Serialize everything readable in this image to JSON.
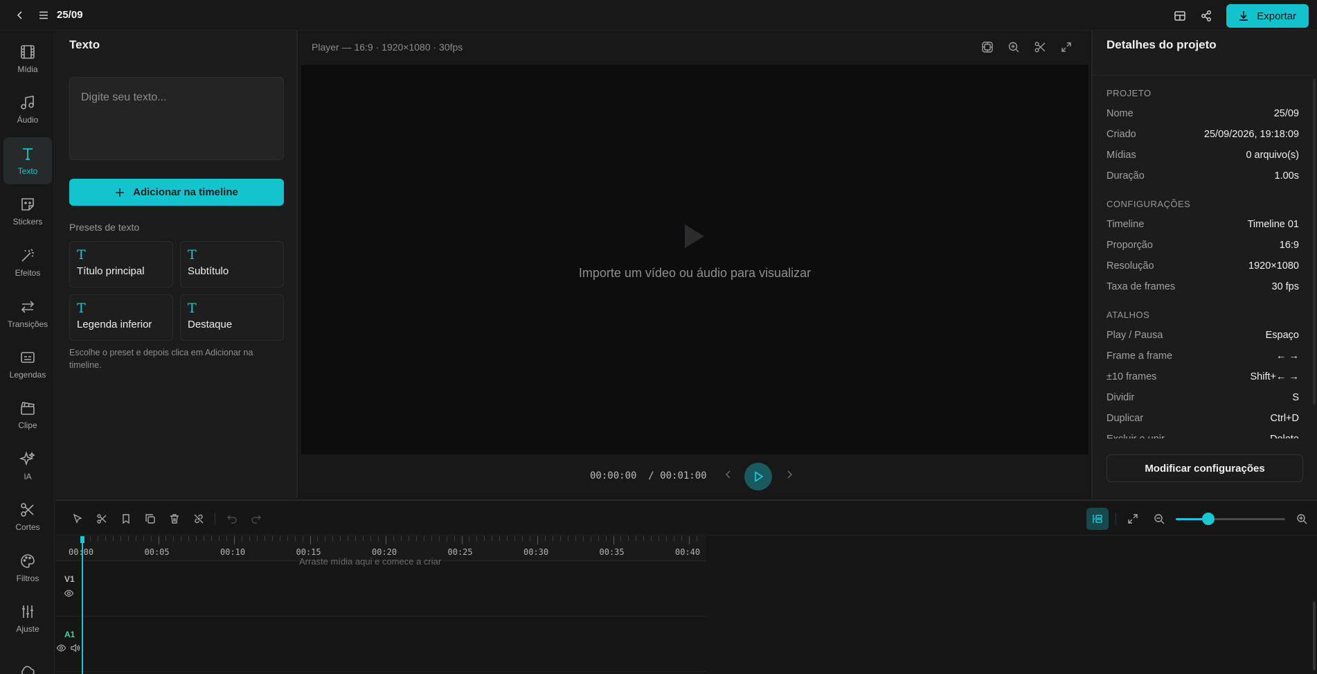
{
  "topbar": {
    "back_icon": "chevron-left-icon",
    "menu_icon": "hamburger-menu-icon",
    "project_title": "25/09",
    "layout_icon": "layout-icon",
    "share_icon": "share-icon",
    "export_label": "Exportar",
    "accent": "#12c3cd"
  },
  "rail": {
    "items": [
      {
        "label": "Mídia",
        "icon": "film-icon"
      },
      {
        "label": "Áudio",
        "icon": "music-note-icon"
      },
      {
        "label": "Texto",
        "icon": "text-icon",
        "active": true
      },
      {
        "label": "Stickers",
        "icon": "sticker-icon"
      },
      {
        "label": "Efeitos",
        "icon": "magic-wand-icon"
      },
      {
        "label": "Transições",
        "icon": "transitions-icon"
      },
      {
        "label": "Legendas",
        "icon": "captions-icon"
      },
      {
        "label": "Clipe",
        "icon": "clapperboard-icon"
      },
      {
        "label": "IA",
        "icon": "sparkles-icon"
      },
      {
        "label": "Cortes",
        "icon": "scissors-icon"
      },
      {
        "label": "Filtros",
        "icon": "palette-icon"
      },
      {
        "label": "Ajuste",
        "icon": "sliders-icon"
      },
      {
        "label": "",
        "icon": "cloud-icon"
      }
    ]
  },
  "text_panel": {
    "title": "Texto",
    "input_placeholder": "Digite seu texto...",
    "input_value": "",
    "add_button": "Adicionar na timeline",
    "presets_label": "Presets de texto",
    "presets": [
      {
        "glyph": "T",
        "label": "Título principal"
      },
      {
        "glyph": "T",
        "label": "Subtítulo"
      },
      {
        "glyph": "T",
        "label": "Legenda inferior"
      },
      {
        "glyph": "T",
        "label": "Destaque"
      }
    ],
    "hint": "Escolhe o preset e depois clica em Adicionar na timeline."
  },
  "player": {
    "header": "Player — 16:9 · 1920×1080 · 30fps",
    "tools": [
      "safe-area-icon",
      "zoom-in-icon",
      "scissors-icon",
      "fullscreen-icon"
    ],
    "empty_message": "Importe um vídeo ou áudio para visualizar",
    "current_time": "00:00:00",
    "total_time": "/ 00:01:00"
  },
  "details": {
    "title": "Detalhes do projeto",
    "sections": [
      {
        "heading": "PROJETO",
        "rows": [
          {
            "key": "Nome",
            "value": "25/09"
          },
          {
            "key": "Criado",
            "value": "25/09/2026, 19:18:09"
          },
          {
            "key": "Mídias",
            "value": "0 arquivo(s)"
          },
          {
            "key": "Duração",
            "value": "1.00s"
          }
        ]
      },
      {
        "heading": "CONFIGURAÇÕES",
        "rows": [
          {
            "key": "Timeline",
            "value": "Timeline 01"
          },
          {
            "key": "Proporção",
            "value": "16:9"
          },
          {
            "key": "Resolução",
            "value": "1920×1080"
          },
          {
            "key": "Taxa de frames",
            "value": "30 fps"
          }
        ]
      },
      {
        "heading": "ATALHOS",
        "rows": [
          {
            "key": "Play / Pausa",
            "value": "Espaço"
          },
          {
            "key": "Frame a frame",
            "value": "← →"
          },
          {
            "key": "±10 frames",
            "value": "Shift+← →"
          },
          {
            "key": "Dividir",
            "value": "S"
          },
          {
            "key": "Duplicar",
            "value": "Ctrl+D"
          },
          {
            "key": "Excluir e unir",
            "value": "Delete"
          }
        ]
      }
    ],
    "modify_button": "Modificar configurações"
  },
  "timeline": {
    "tools": [
      "select-pointer-icon",
      "scissors-icon",
      "bookmark-icon",
      "duplicate-icon",
      "trash-icon",
      "unlink-icon",
      "undo-icon",
      "redo-icon"
    ],
    "zoom_level": 0.3,
    "ruler_labels": [
      "00:00",
      "00:05",
      "00:10",
      "00:15",
      "00:20",
      "00:25",
      "00:30",
      "00:35",
      "00:40"
    ],
    "drop_hint": "Arraste mídia aqui e comece a criar",
    "tracks": [
      {
        "label": "V1",
        "type": "video"
      },
      {
        "label": "A1",
        "type": "audio"
      }
    ]
  }
}
